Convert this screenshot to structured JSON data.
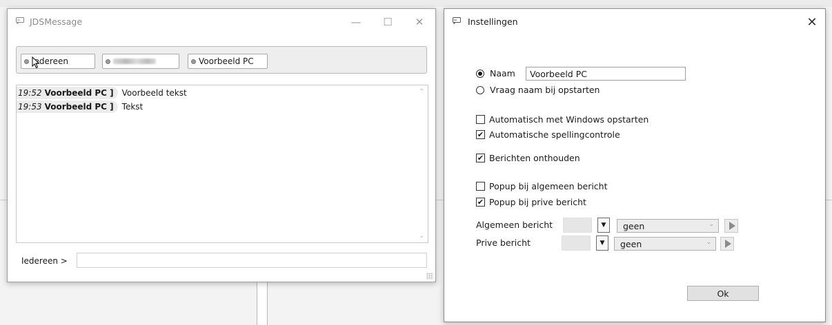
{
  "jds_window": {
    "title": "JDSMessage",
    "minimize_glyph": "—",
    "maximize_glyph": "☐",
    "close_glyph": "✕",
    "recipients": [
      {
        "label": "Iedereen",
        "selected": true
      },
      {
        "label": "",
        "blurred": true
      },
      {
        "label": "Voorbeeld PC"
      }
    ],
    "messages": [
      {
        "time": "19:52",
        "sender": "Voorbeeld PC ]",
        "text": "Voorbeeld tekst"
      },
      {
        "time": "19:53",
        "sender": "Voorbeeld PC ]",
        "text": "Tekst"
      }
    ],
    "input": {
      "label": "Iedereen  >",
      "value": ""
    },
    "icons": {
      "app": "chat-bubble-icon",
      "cursor": "mouse-pointer-icon"
    }
  },
  "settings_window": {
    "title": "Instellingen",
    "close_glyph": "✕",
    "name_option": {
      "label": "Naam",
      "selected": true,
      "value": "Voorbeeld PC"
    },
    "ask_option": {
      "label": "Vraag naam bij opstarten",
      "selected": false
    },
    "checkboxes": [
      {
        "label": "Automatisch met Windows opstarten",
        "checked": false
      },
      {
        "label": "Automatische spellingcontrole",
        "checked": true
      },
      {
        "label": "Berichten onthouden",
        "checked": true
      },
      {
        "label": "Popup bij algemeen bericht",
        "checked": false
      },
      {
        "label": "Popup bij prive bericht",
        "checked": true
      }
    ],
    "sounds": [
      {
        "label": "Algemeen bericht",
        "value": "geen"
      },
      {
        "label": "Prive bericht",
        "value": "geen"
      }
    ],
    "ok_label": "Ok",
    "check_glyph": "✔",
    "dropdown_glyph": "▼",
    "chevron_glyph": "⌄"
  },
  "colors": {
    "window_bg": "#ffffff",
    "desktop_bg": "#f3f3f3",
    "meta_bg": "#ececec",
    "title_gray": "#8a8a8a"
  }
}
